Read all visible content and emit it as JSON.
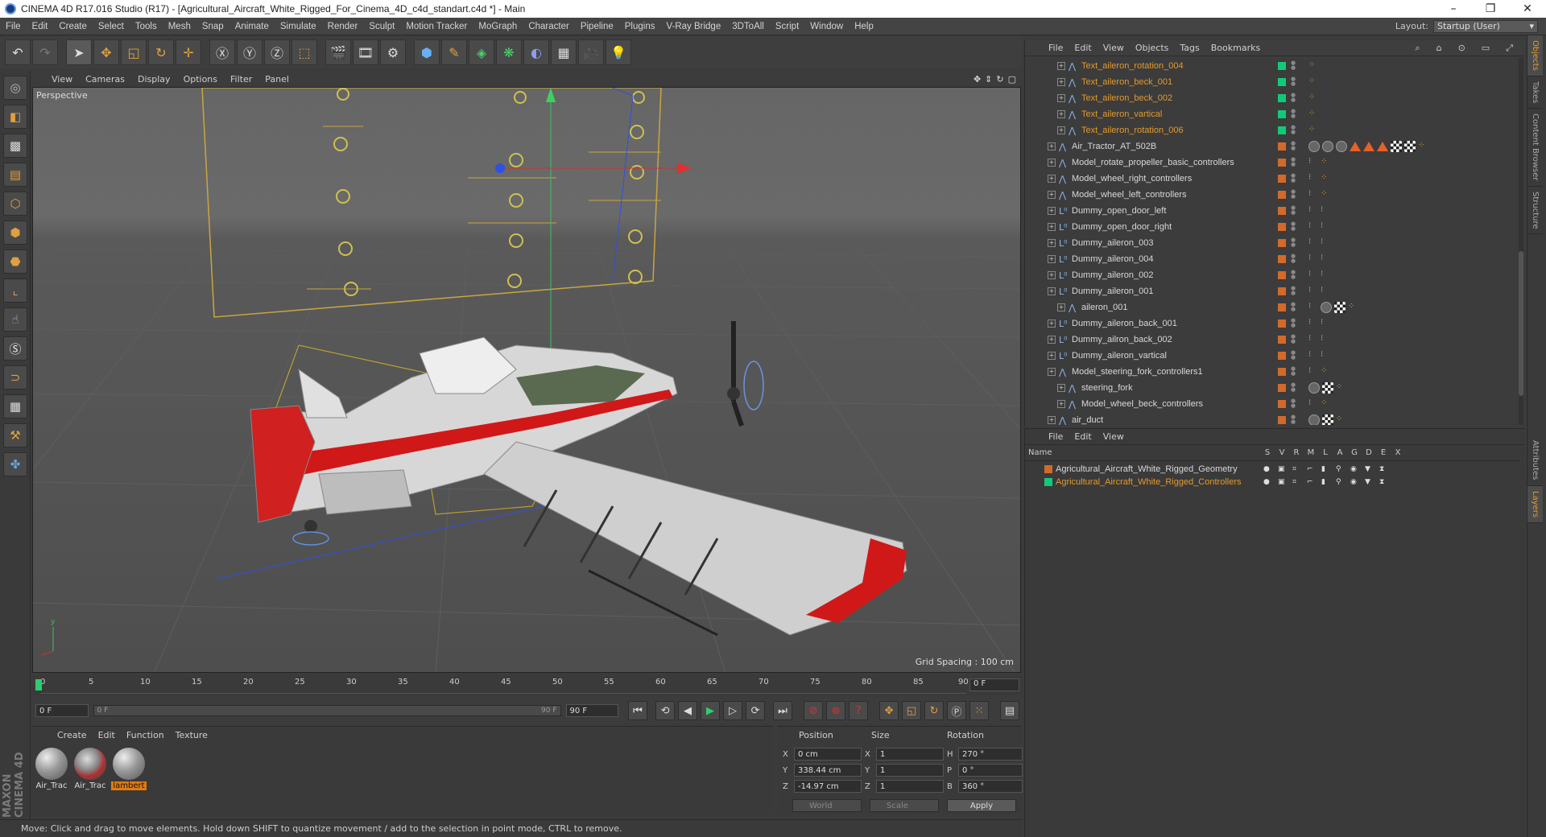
{
  "window": {
    "title": "CINEMA 4D R17.016 Studio (R17) - [Agricultural_Aircraft_White_Rigged_For_Cinema_4D_c4d_standart.c4d *] - Main"
  },
  "menu": [
    "File",
    "Edit",
    "Create",
    "Select",
    "Tools",
    "Mesh",
    "Snap",
    "Animate",
    "Simulate",
    "Render",
    "Sculpt",
    "Motion Tracker",
    "MoGraph",
    "Character",
    "Pipeline",
    "Plugins",
    "V-Ray Bridge",
    "3DToAll",
    "Script",
    "Window",
    "Help"
  ],
  "layout": {
    "label": "Layout:",
    "value": "Startup (User)"
  },
  "viewport": {
    "menu": [
      "View",
      "Cameras",
      "Display",
      "Options",
      "Filter",
      "Panel"
    ],
    "label": "Perspective",
    "grid_spacing": "Grid Spacing : 100 cm"
  },
  "timeline": {
    "ticks": [
      "0",
      "5",
      "10",
      "15",
      "20",
      "25",
      "30",
      "35",
      "40",
      "45",
      "50",
      "55",
      "60",
      "65",
      "70",
      "75",
      "80",
      "85",
      "90"
    ],
    "current_frame": "0 F",
    "start_field": "0 F",
    "slider_left": "0 F",
    "slider_right": "90 F",
    "end_field": "90 F"
  },
  "materials": {
    "menu": [
      "Create",
      "Edit",
      "Function",
      "Texture"
    ],
    "items": [
      {
        "label": "Air_Trac"
      },
      {
        "label": "Air_Trac"
      },
      {
        "label": "lambert"
      }
    ]
  },
  "coords": {
    "headers": [
      "Position",
      "Size",
      "Rotation"
    ],
    "rows": [
      {
        "pa": "X",
        "pv": "0 cm",
        "sa": "X",
        "sv": "1",
        "ra": "H",
        "rv": "270 °"
      },
      {
        "pa": "Y",
        "pv": "338.44 cm",
        "sa": "Y",
        "sv": "1",
        "ra": "P",
        "rv": "0 °"
      },
      {
        "pa": "Z",
        "pv": "-14.97 cm",
        "sa": "Z",
        "sv": "1",
        "ra": "B",
        "rv": "360 °"
      }
    ],
    "mode1": "World",
    "mode2": "Scale",
    "apply": "Apply"
  },
  "status": "Move: Click and drag to move elements. Hold down SHIFT to quantize movement / add to the selection in point mode, CTRL to remove.",
  "object_manager": {
    "menu": [
      "File",
      "Edit",
      "View",
      "Objects",
      "Tags",
      "Bookmarks"
    ],
    "items": [
      {
        "name": "Text_aileron_rotation_004",
        "depth": 1,
        "hl": true,
        "green": true,
        "icon": "joint"
      },
      {
        "name": "Text_aileron_beck_001",
        "depth": 1,
        "hl": true,
        "green": true,
        "icon": "joint"
      },
      {
        "name": "Text_aileron_beck_002",
        "depth": 1,
        "hl": true,
        "green": true,
        "icon": "joint"
      },
      {
        "name": "Text_aileron_vartical",
        "depth": 1,
        "hl": true,
        "green": true,
        "icon": "joint"
      },
      {
        "name": "Text_aileron_rotation_006",
        "depth": 1,
        "hl": true,
        "green": true,
        "icon": "joint"
      },
      {
        "name": "Air_Tractor_AT_502B",
        "depth": 0,
        "hl": false,
        "green": false,
        "icon": "joint"
      },
      {
        "name": "Model_rotate_propeller_basic_controllers",
        "depth": 0,
        "hl": false,
        "green": false,
        "icon": "joint"
      },
      {
        "name": "Model_wheel_right_controllers",
        "depth": 0,
        "hl": false,
        "green": false,
        "icon": "joint"
      },
      {
        "name": "Model_wheel_left_controllers",
        "depth": 0,
        "hl": false,
        "green": false,
        "icon": "joint"
      },
      {
        "name": "Dummy_open_door_left",
        "depth": 0,
        "hl": false,
        "green": false,
        "icon": "null"
      },
      {
        "name": "Dummy_open_door_right",
        "depth": 0,
        "hl": false,
        "green": false,
        "icon": "null"
      },
      {
        "name": "Dummy_aileron_003",
        "depth": 0,
        "hl": false,
        "green": false,
        "icon": "null"
      },
      {
        "name": "Dummy_aileron_004",
        "depth": 0,
        "hl": false,
        "green": false,
        "icon": "null"
      },
      {
        "name": "Dummy_aileron_002",
        "depth": 0,
        "hl": false,
        "green": false,
        "icon": "null"
      },
      {
        "name": "Dummy_aileron_001",
        "depth": 0,
        "hl": false,
        "green": false,
        "icon": "null"
      },
      {
        "name": "aileron_001",
        "depth": 1,
        "hl": false,
        "green": false,
        "icon": "joint"
      },
      {
        "name": "Dummy_aileron_back_001",
        "depth": 0,
        "hl": false,
        "green": false,
        "icon": "null"
      },
      {
        "name": "Dummy_ailron_back_002",
        "depth": 0,
        "hl": false,
        "green": false,
        "icon": "null"
      },
      {
        "name": "Dummy_aileron_vartical",
        "depth": 0,
        "hl": false,
        "green": false,
        "icon": "null"
      },
      {
        "name": "Model_steering_fork_controllers1",
        "depth": 0,
        "hl": false,
        "green": false,
        "icon": "joint"
      },
      {
        "name": "steering_fork",
        "depth": 1,
        "hl": false,
        "green": false,
        "icon": "joint"
      },
      {
        "name": "Model_wheel_beck_controllers",
        "depth": 1,
        "hl": false,
        "green": false,
        "icon": "joint"
      },
      {
        "name": "air_duct",
        "depth": 0,
        "hl": false,
        "green": false,
        "icon": "joint"
      }
    ]
  },
  "layer_manager": {
    "menu": [
      "File",
      "Edit",
      "View"
    ],
    "header": {
      "name": "Name",
      "cols": [
        "S",
        "V",
        "R",
        "M",
        "L",
        "A",
        "G",
        "D",
        "E",
        "X"
      ]
    },
    "layers": [
      {
        "name": "Agricultural_Aircraft_White_Rigged_Geometry",
        "color": "#d26a2a",
        "text": "#d8d8d8"
      },
      {
        "name": "Agricultural_Aircraft_White_Rigged_Controllers",
        "color": "#12c97a",
        "text": "#e59a2b"
      }
    ]
  },
  "right_tabs": [
    "Objects",
    "Takes",
    "Content Browser",
    "Structure",
    "Attributes",
    "Layers"
  ],
  "colors": {
    "accent": "#e59a2b",
    "layer_orange": "#d26a2a",
    "layer_green": "#12c97a"
  }
}
